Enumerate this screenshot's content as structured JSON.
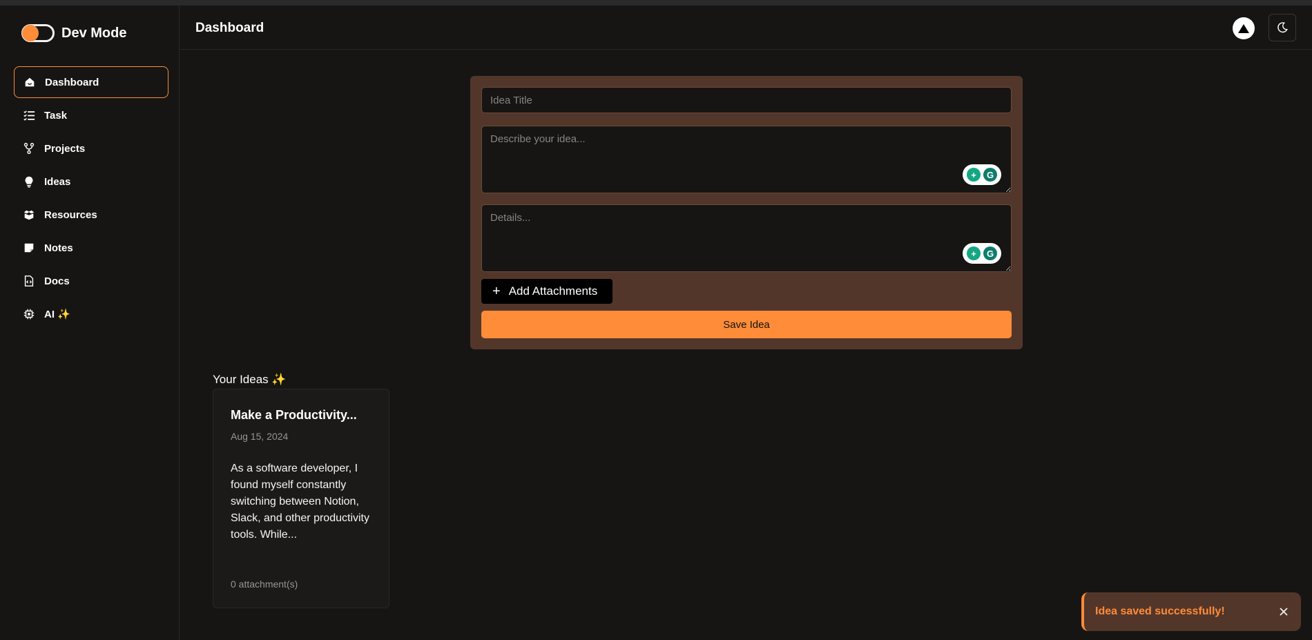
{
  "app": {
    "name": "Dev Mode"
  },
  "header": {
    "title": "Dashboard"
  },
  "sidebar": {
    "items": [
      {
        "label": "Dashboard",
        "icon": "home-icon",
        "active": true
      },
      {
        "label": "Task",
        "icon": "checklist-icon"
      },
      {
        "label": "Projects",
        "icon": "git-branch-icon"
      },
      {
        "label": "Ideas",
        "icon": "lightbulb-icon"
      },
      {
        "label": "Resources",
        "icon": "box-icon"
      },
      {
        "label": "Notes",
        "icon": "note-icon"
      },
      {
        "label": "Docs",
        "icon": "code-file-icon"
      },
      {
        "label": "AI ✨",
        "icon": "chip-icon"
      }
    ]
  },
  "form": {
    "title_placeholder": "Idea Title",
    "title_value": "",
    "description_placeholder": "Describe your idea...",
    "description_value": "",
    "details_placeholder": "Details...",
    "details_value": "",
    "attach_label": "Add Attachments",
    "save_label": "Save Idea"
  },
  "ideas": {
    "heading": "Your Ideas ✨",
    "items": [
      {
        "title": "Make a Productivity...",
        "date": "Aug 15, 2024",
        "body": "As a software developer, I found myself constantly switching between Notion, Slack, and other productivity tools. While...",
        "attachments": "0 attachment(s)"
      }
    ]
  },
  "toast": {
    "message": "Idea saved successfully!"
  },
  "colors": {
    "accent": "#ff8c38",
    "card": "#53362a",
    "background": "#161514"
  }
}
